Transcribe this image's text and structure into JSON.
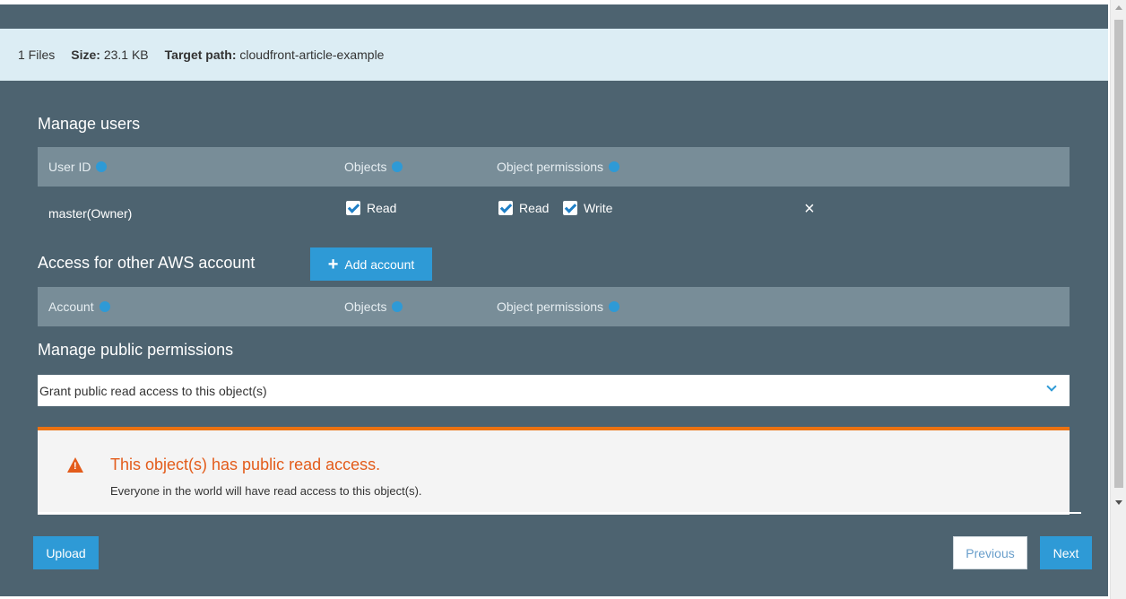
{
  "info_bar": {
    "files": "1 Files",
    "size_label": "Size:",
    "size_value": "23.1 KB",
    "target_label": "Target path:",
    "target_value": "cloudfront-article-example"
  },
  "manage_users": {
    "title": "Manage users",
    "headers": {
      "user_id": "User ID",
      "objects": "Objects",
      "object_permissions": "Object permissions"
    },
    "row": {
      "user": "master(Owner)",
      "objects_read": "Read",
      "perm_read": "Read",
      "perm_write": "Write",
      "remove_icon": "×"
    }
  },
  "other_accounts": {
    "title": "Access for other AWS account",
    "add_button": "Add account",
    "add_icon": "+",
    "headers": {
      "account": "Account",
      "objects": "Objects",
      "object_permissions": "Object permissions"
    }
  },
  "public_permissions": {
    "title": "Manage public permissions",
    "select_value": "Grant public read access to this object(s)"
  },
  "alert": {
    "title": "This object(s) has public read access.",
    "text": "Everyone in the world will have read access to this object(s)."
  },
  "footer": {
    "upload": "Upload",
    "previous": "Previous",
    "next": "Next"
  },
  "colors": {
    "modal_bg": "#4d6370",
    "accent": "#2e9ad6",
    "warning": "#e35c1b",
    "warning_border": "#ec7211",
    "info_bar_bg": "#dcedf4"
  }
}
